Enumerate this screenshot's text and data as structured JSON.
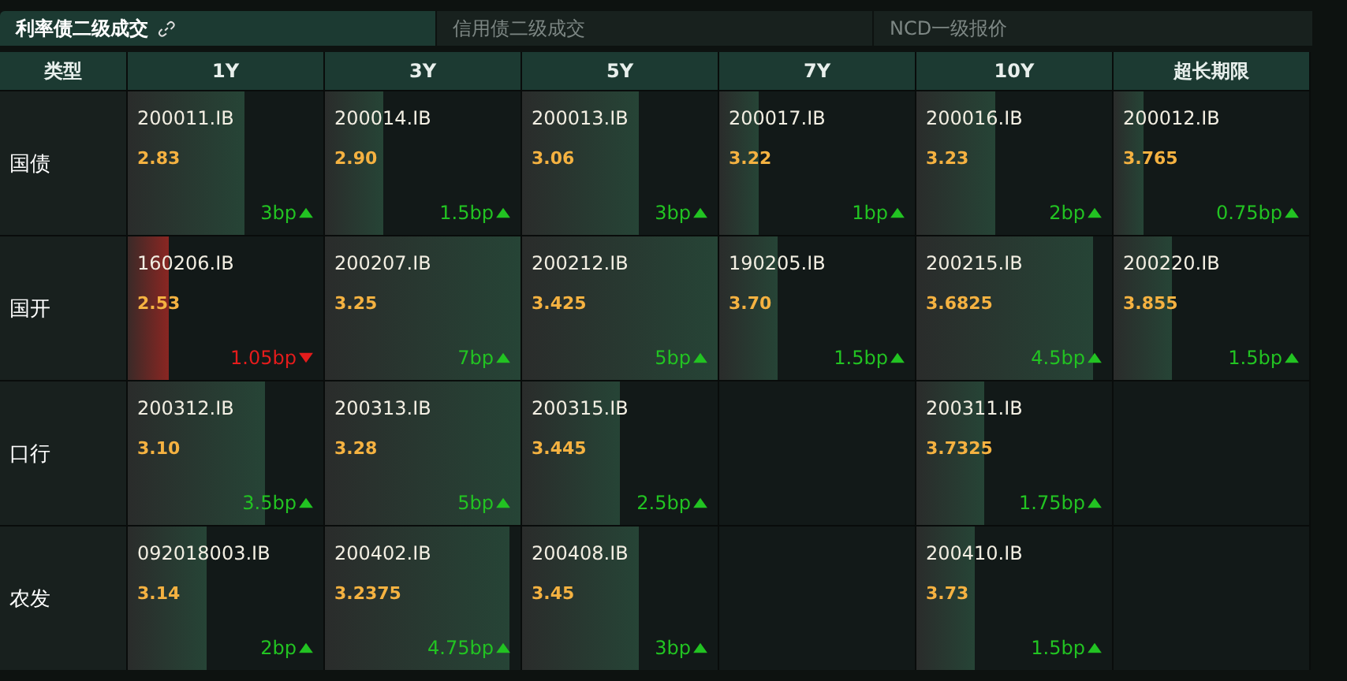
{
  "tabs": [
    {
      "label": "利率债二级成交",
      "selected": true,
      "linked": true
    },
    {
      "label": "信用债二级成交",
      "selected": false,
      "linked": false
    },
    {
      "label": "NCD一级报价",
      "selected": false,
      "linked": false
    }
  ],
  "table": {
    "columns": [
      "类型",
      "1Y",
      "3Y",
      "5Y",
      "7Y",
      "10Y",
      "超长期限"
    ],
    "rows": [
      {
        "cells": [
          {
            "kind": "label",
            "text": "国债"
          },
          {
            "kind": "up",
            "code": "200011.IB",
            "yield": "2.83",
            "change": "3bp",
            "level": 0.6
          },
          {
            "kind": "up",
            "code": "200014.IB",
            "yield": "2.90",
            "change": "1.5bp",
            "level": 0.3
          },
          {
            "kind": "up",
            "code": "200013.IB",
            "yield": "3.06",
            "change": "3bp",
            "level": 0.6
          },
          {
            "kind": "up",
            "code": "200017.IB",
            "yield": "3.22",
            "change": "1bp",
            "level": 0.2
          },
          {
            "kind": "up",
            "code": "200016.IB",
            "yield": "3.23",
            "change": "2bp",
            "level": 0.4
          },
          {
            "kind": "up",
            "code": "200012.IB",
            "yield": "3.765",
            "change": "0.75bp",
            "level": 0.15
          }
        ]
      },
      {
        "cells": [
          {
            "kind": "label",
            "text": "国开"
          },
          {
            "kind": "down",
            "code": "160206.IB",
            "yield": "2.53",
            "change": "1.05bp",
            "level": 0.21
          },
          {
            "kind": "up",
            "code": "200207.IB",
            "yield": "3.25",
            "change": "7bp",
            "level": 1
          },
          {
            "kind": "up",
            "code": "200212.IB",
            "yield": "3.425",
            "change": "5bp",
            "level": 1
          },
          {
            "kind": "up",
            "code": "190205.IB",
            "yield": "3.70",
            "change": "1.5bp",
            "level": 0.3
          },
          {
            "kind": "up",
            "code": "200215.IB",
            "yield": "3.6825",
            "change": "4.5bp",
            "level": 0.9
          },
          {
            "kind": "up",
            "code": "200220.IB",
            "yield": "3.855",
            "change": "1.5bp",
            "level": 0.3
          }
        ]
      },
      {
        "cells": [
          {
            "kind": "label",
            "text": "口行"
          },
          {
            "kind": "up",
            "code": "200312.IB",
            "yield": "3.10",
            "change": "3.5bp",
            "level": 0.7
          },
          {
            "kind": "up",
            "code": "200313.IB",
            "yield": "3.28",
            "change": "5bp",
            "level": 1
          },
          {
            "kind": "up",
            "code": "200315.IB",
            "yield": "3.445",
            "change": "2.5bp",
            "level": 0.5
          },
          "",
          {
            "kind": "up",
            "code": "200311.IB",
            "yield": "3.7325",
            "change": "1.75bp",
            "level": 0.35
          },
          ""
        ]
      },
      {
        "cells": [
          {
            "kind": "label",
            "text": "农发"
          },
          {
            "kind": "up",
            "code": "092018003.IB",
            "yield": "3.14",
            "change": "2bp",
            "level": 0.4
          },
          {
            "kind": "up",
            "code": "200402.IB",
            "yield": "3.2375",
            "change": "4.75bp",
            "level": 0.94
          },
          {
            "kind": "up",
            "code": "200408.IB",
            "yield": "3.45",
            "change": "3bp",
            "level": 0.6
          },
          "",
          {
            "kind": "up",
            "code": "200410.IB",
            "yield": "3.73",
            "change": "1.5bp",
            "level": 0.3
          },
          ""
        ]
      }
    ]
  }
}
